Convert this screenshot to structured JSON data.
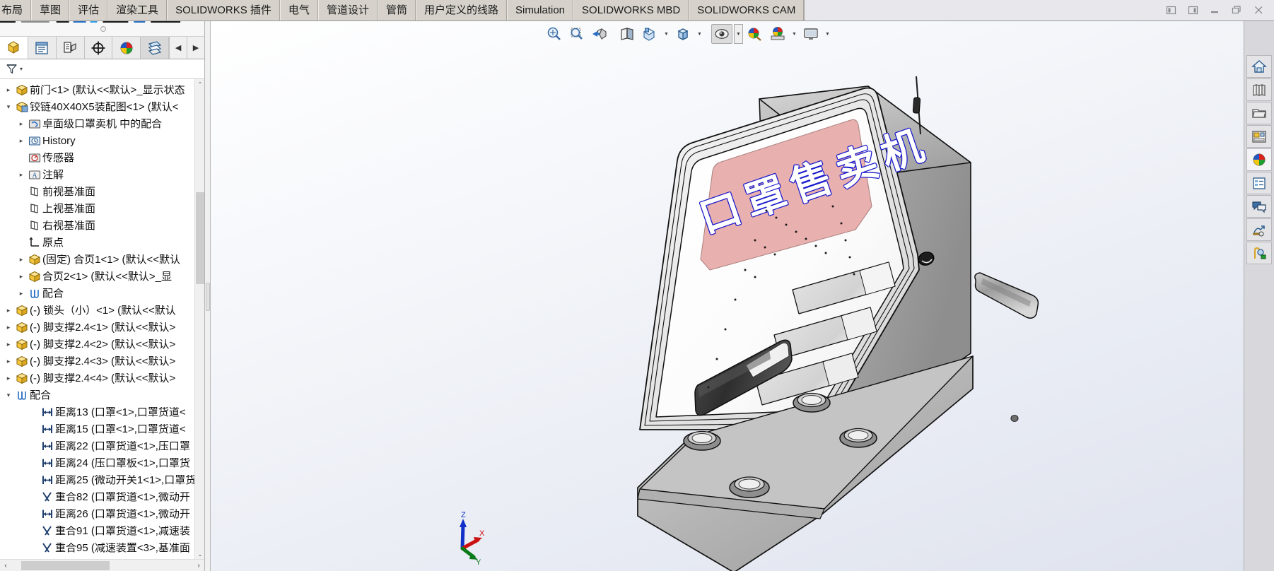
{
  "tabbar": {
    "tabs": [
      {
        "label": "布局",
        "clipped": true
      },
      {
        "label": "草图"
      },
      {
        "label": "评估"
      },
      {
        "label": "渲染工具"
      },
      {
        "label": "SOLIDWORKS 插件"
      },
      {
        "label": "电气"
      },
      {
        "label": "管道设计"
      },
      {
        "label": "管筒"
      },
      {
        "label": "用户定义的线路"
      },
      {
        "label": "Simulation"
      },
      {
        "label": "SOLIDWORKS MBD"
      },
      {
        "label": "SOLIDWORKS CAM"
      }
    ],
    "window_controls": [
      {
        "name": "collapse-left-panel-button"
      },
      {
        "name": "collapse-right-panel-button"
      },
      {
        "name": "minimize-button"
      },
      {
        "name": "restore-button"
      },
      {
        "name": "close-button"
      }
    ]
  },
  "left_panel": {
    "panel_tabs": [
      {
        "name": "feature-manager-tab",
        "icon": "yellow-cube-icon",
        "state": "active"
      },
      {
        "name": "property-manager-tab",
        "icon": "property-list-icon",
        "state": "normal"
      },
      {
        "name": "configuration-manager-tab",
        "icon": "configuration-icon",
        "state": "normal"
      },
      {
        "name": "dimxpert-manager-tab",
        "icon": "crosshair-icon",
        "state": "normal"
      },
      {
        "name": "appearance-manager-tab",
        "icon": "color-sphere-icon",
        "state": "normal"
      },
      {
        "name": "display-manager-tab",
        "icon": "display-pane-icon",
        "state": "selected"
      }
    ],
    "nav_prev": "◀",
    "nav_next": "▶",
    "filter": {
      "icon": "filter-funnel-icon",
      "dropdown": "▾"
    },
    "tree": [
      {
        "indent": 0,
        "twist": "▸",
        "icon": "part",
        "label": "前门<1> (默认<<默认>_显示状态"
      },
      {
        "indent": 0,
        "twist": "▾",
        "icon": "assembly",
        "label": "铰链40X40X5装配图<1> (默认<"
      },
      {
        "indent": 1,
        "twist": "▸",
        "icon": "mates-folder",
        "label": "卓面级口罩卖机 中的配合"
      },
      {
        "indent": 1,
        "twist": "▸",
        "icon": "history",
        "label": "History"
      },
      {
        "indent": 1,
        "twist": "",
        "icon": "sensor",
        "label": "传感器"
      },
      {
        "indent": 1,
        "twist": "▸",
        "icon": "annotation",
        "label": "注解"
      },
      {
        "indent": 1,
        "twist": "",
        "icon": "plane",
        "label": "前视基准面"
      },
      {
        "indent": 1,
        "twist": "",
        "icon": "plane",
        "label": "上视基准面"
      },
      {
        "indent": 1,
        "twist": "",
        "icon": "plane",
        "label": "右视基准面"
      },
      {
        "indent": 1,
        "twist": "",
        "icon": "origin",
        "label": "原点"
      },
      {
        "indent": 1,
        "twist": "▸",
        "icon": "part",
        "label": "(固定) 合页1<1> (默认<<默认"
      },
      {
        "indent": 1,
        "twist": "▸",
        "icon": "part",
        "label": "合页2<1> (默认<<默认>_显"
      },
      {
        "indent": 1,
        "twist": "▸",
        "icon": "mates",
        "label": "配合"
      },
      {
        "indent": 0,
        "twist": "▸",
        "icon": "part",
        "label": "(-) 锁头（小）<1> (默认<<默认"
      },
      {
        "indent": 0,
        "twist": "▸",
        "icon": "part",
        "label": "(-) 脚支撑2.4<1> (默认<<默认>"
      },
      {
        "indent": 0,
        "twist": "▸",
        "icon": "part",
        "label": "(-) 脚支撑2.4<2> (默认<<默认>"
      },
      {
        "indent": 0,
        "twist": "▸",
        "icon": "part",
        "label": "(-) 脚支撑2.4<3> (默认<<默认>"
      },
      {
        "indent": 0,
        "twist": "▸",
        "icon": "part",
        "label": "(-) 脚支撑2.4<4> (默认<<默认>"
      },
      {
        "indent": 0,
        "twist": "▾",
        "icon": "mates",
        "label": "配合"
      },
      {
        "indent": 2,
        "twist": "",
        "icon": "distance",
        "label": "距离13 (口罩<1>,口罩货道<"
      },
      {
        "indent": 2,
        "twist": "",
        "icon": "distance",
        "label": "距离15 (口罩<1>,口罩货道<"
      },
      {
        "indent": 2,
        "twist": "",
        "icon": "distance",
        "label": "距离22 (口罩货道<1>,压口罩"
      },
      {
        "indent": 2,
        "twist": "",
        "icon": "distance",
        "label": "距离24 (压口罩板<1>,口罩货"
      },
      {
        "indent": 2,
        "twist": "",
        "icon": "distance",
        "label": "距离25 (微动开关1<1>,口罩货"
      },
      {
        "indent": 2,
        "twist": "",
        "icon": "coincident",
        "label": "重合82 (口罩货道<1>,微动开"
      },
      {
        "indent": 2,
        "twist": "",
        "icon": "distance",
        "label": "距离26 (口罩货道<1>,微动开"
      },
      {
        "indent": 2,
        "twist": "",
        "icon": "coincident",
        "label": "重合91 (口罩货道<1>,减速装"
      },
      {
        "indent": 2,
        "twist": "",
        "icon": "coincident",
        "label": "重合95 (减速装置<3>,基准面"
      }
    ],
    "hscroll": {
      "left_arrow": "‹",
      "right_arrow": "›"
    },
    "vscroll": {
      "up_arrow": "⌃",
      "down_arrow": "⌄"
    }
  },
  "view_toolbar": [
    {
      "name": "zoom-to-fit-button",
      "icon": "magnifier-fit-icon",
      "dropdown": false,
      "active": false
    },
    {
      "name": "zoom-to-area-button",
      "icon": "magnifier-area-icon",
      "dropdown": false,
      "active": false
    },
    {
      "name": "previous-view-button",
      "icon": "previous-view-icon",
      "dropdown": false,
      "active": false
    },
    {
      "name": "section-view-button",
      "icon": "section-view-icon",
      "dropdown": false,
      "active": false
    },
    {
      "name": "view-orientation-button",
      "icon": "view-orientation-icon",
      "dropdown": true,
      "active": false
    },
    {
      "name": "display-style-button",
      "icon": "display-style-cube-icon",
      "dropdown": true,
      "active": false
    },
    {
      "name": "hide-show-items-button",
      "icon": "eye-icon",
      "dropdown": true,
      "active": true
    },
    {
      "name": "edit-appearance-button",
      "icon": "appearance-sphere-icon",
      "dropdown": false,
      "active": false
    },
    {
      "name": "apply-scene-button",
      "icon": "scene-icon",
      "dropdown": true,
      "active": false
    },
    {
      "name": "view-settings-button",
      "icon": "monitor-icon",
      "dropdown": true,
      "active": false
    }
  ],
  "model": {
    "sign_text": "口罩售卖机",
    "sign_band_color": "#e8b0ae",
    "sign_text_color": "#1a1acc",
    "body_front_color": "#fbfbfb",
    "body_side_color": "#a7a7a7",
    "base_color": "#bcbcbc",
    "tray_color": "#3a3a3a",
    "outline_color": "#111111"
  },
  "triad": {
    "axes": [
      {
        "label": "Z",
        "color": "#1030c8"
      },
      {
        "label": "X",
        "color": "#cc1111"
      },
      {
        "label": "Y",
        "color": "#0b7a18"
      }
    ]
  },
  "task_pane": [
    {
      "name": "solidworks-resources-button",
      "icon": "home-icon",
      "lit": false
    },
    {
      "name": "design-library-button",
      "icon": "books-icon",
      "lit": false
    },
    {
      "name": "file-explorer-button",
      "icon": "folder-icon",
      "lit": false
    },
    {
      "name": "view-palette-button",
      "icon": "view-palette-icon",
      "lit": false
    },
    {
      "name": "appearances-scenes-button",
      "icon": "color-sphere-icon",
      "lit": true
    },
    {
      "name": "custom-properties-button",
      "icon": "properties-list-icon",
      "lit": false
    },
    {
      "name": "solidworks-forum-button",
      "icon": "speech-bubbles-icon",
      "lit": false
    },
    {
      "name": "simulation-button",
      "icon": "simulation-icon",
      "lit": false
    },
    {
      "name": "motion-study-button",
      "icon": "motion-study-icon",
      "lit": false
    }
  ]
}
